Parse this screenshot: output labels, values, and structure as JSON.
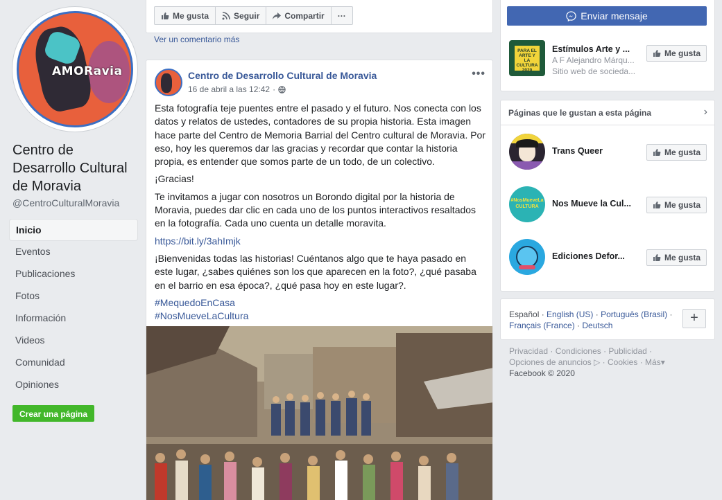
{
  "page": {
    "name": "Centro de Desarrollo Cultural de Moravia",
    "handle": "@CentroCulturalMoravia",
    "avatar_text": "AMORavia"
  },
  "nav": {
    "items": [
      {
        "label": "Inicio",
        "active": true
      },
      {
        "label": "Eventos"
      },
      {
        "label": "Publicaciones"
      },
      {
        "label": "Fotos"
      },
      {
        "label": "Información"
      },
      {
        "label": "Videos"
      },
      {
        "label": "Comunidad"
      },
      {
        "label": "Opiniones"
      }
    ],
    "create_page": "Crear una página"
  },
  "actions": {
    "like": "Me gusta",
    "follow": "Seguir",
    "share": "Compartir",
    "more": "···"
  },
  "comments": {
    "more": "Ver un comentario más"
  },
  "post": {
    "author": "Centro de Desarrollo Cultural de Moravia",
    "date": "16 de abril a las 12:42",
    "privacy_icon": "globe-icon",
    "menu": "•••",
    "paragraphs": [
      "Esta fotografía teje puentes entre el pasado y el futuro. Nos conecta con los datos y relatos de ustedes, contadores de su propia historia. Esta imagen hace parte del Centro de Memoria Barrial del Centro cultural de Moravia. Por eso, hoy les queremos dar las gracias y recordar que contar la historia propia, es entender que somos parte de un todo, de un colectivo.",
      "¡Gracias!",
      "Te invitamos a jugar con nosotros un Borondo digital por la historia de Moravia, puedes dar clic en cada uno de los puntos interactivos resaltados en la fotografía. Cada uno cuenta un detalle moravita."
    ],
    "link": "https://bit.ly/3ahImjk",
    "closing": "¡Bienvenidas todas las historias! Cuéntanos algo que te haya pasado en este lugar, ¿sabes quiénes son los que aparecen en la foto?, ¿qué pasaba en el barrio en esa época?, ¿qué pasa hoy en este lugar?.",
    "hashtags": [
      "#MequedoEnCasa",
      "#NosMueveLaCultura"
    ]
  },
  "right": {
    "send_message": "Enviar mensaje",
    "featured": {
      "name": "Estímulos Arte y ...",
      "sub1": "A F Alejandro Márqu...",
      "sub2": "Sitio web de socieda...",
      "thumb_text": "PARA EL ARTE Y LA CULTURA 2020",
      "like": "Me gusta"
    },
    "liked_pages_title": "Páginas que le gustan a esta página",
    "liked_pages": [
      {
        "name": "Trans Queer",
        "like": "Me gusta"
      },
      {
        "name": "Nos Mueve la Cul...",
        "like": "Me gusta",
        "thumb_text": "#NosMueveLa CULTURA"
      },
      {
        "name": "Ediciones Defor...",
        "like": "Me gusta"
      }
    ],
    "languages": {
      "current": "Español",
      "others": [
        "English (US)",
        "Português (Brasil)",
        "Français (France)",
        "Deutsch"
      ],
      "plus": "+"
    },
    "footer": {
      "links": [
        "Privacidad",
        "Condiciones",
        "Publicidad",
        "Opciones de anuncios",
        "Cookies",
        "Más"
      ],
      "copyright": "Facebook © 2020"
    }
  },
  "colors": {
    "fb_blue": "#4267b2",
    "link": "#385898",
    "green": "#42b72a",
    "bg": "#e9ebee"
  }
}
